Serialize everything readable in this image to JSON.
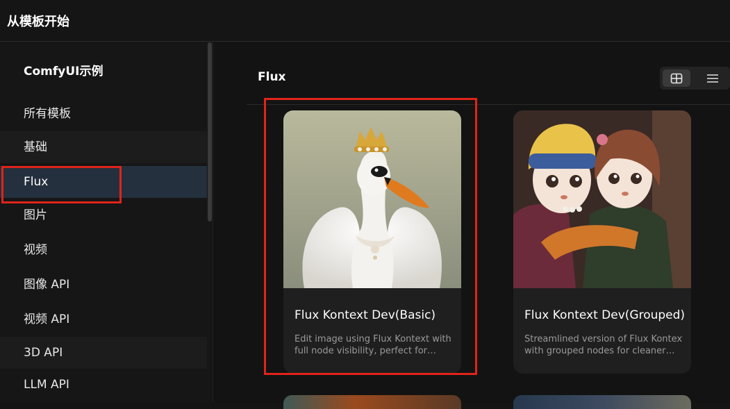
{
  "window": {
    "title": "从模板开始"
  },
  "sidebar": {
    "heading": "ComfyUI示例",
    "items": [
      {
        "label": "所有模板"
      },
      {
        "label": "基础"
      },
      {
        "label": "Flux"
      },
      {
        "label": "图片"
      },
      {
        "label": "视频"
      },
      {
        "label": "图像 API"
      },
      {
        "label": "视频 API"
      },
      {
        "label": "3D API"
      },
      {
        "label": "LLM API"
      }
    ],
    "active_item": "Flux"
  },
  "main": {
    "section_title": "Flux",
    "view_toggle": {
      "grid_icon": "grid-icon",
      "list_icon": "list-icon",
      "selected": "grid"
    },
    "cards": [
      {
        "title": "Flux Kontext Dev(Basic)",
        "desc_line1": "Edit image using Flux Kontext with",
        "desc_line2": "full node visibility, perfect for…",
        "thumbnail": "swan-with-crown-image"
      },
      {
        "title": "Flux Kontext Dev(Grouped)",
        "desc_line1": "Streamlined version of Flux Kontext",
        "desc_line2": "with grouped nodes for cleaner…",
        "thumbnail": "two-dolls-hugging-image"
      }
    ]
  },
  "colors": {
    "highlight_box": "#e0241a",
    "active_item_bg": "#25303e",
    "card_bg": "#1f1f1f"
  }
}
